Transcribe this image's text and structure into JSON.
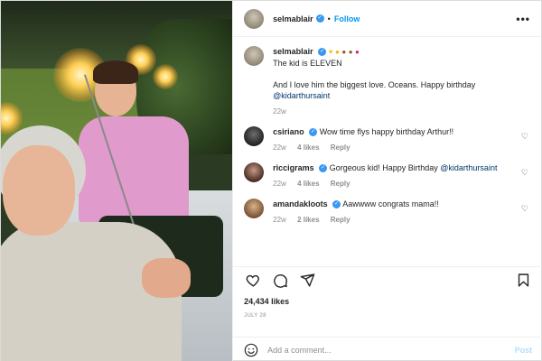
{
  "post": {
    "author": "selmablair",
    "follow_label": "Follow",
    "more_label": "•••",
    "caption_line1": "The kid is ELEVEN",
    "caption_line2_prefix": "And I love him the biggest love. Oceans. Happy birthday",
    "caption_mention": "@kidarthursaint",
    "caption_time": "22w"
  },
  "comments": [
    {
      "user": "csiriano",
      "text": "Wow time flys happy birthday Arthur!!",
      "time": "22w",
      "likes": "4 likes",
      "reply": "Reply"
    },
    {
      "user": "riccigrams",
      "text_prefix": "Gorgeous kid! Happy Birthday ",
      "mention": "@kidarthursaint",
      "time": "22w",
      "likes": "4 likes",
      "reply": "Reply"
    },
    {
      "user": "amandakloots",
      "text": "Aawwww congrats mama!!",
      "time": "22w",
      "likes": "2 likes",
      "reply": "Reply"
    }
  ],
  "stats": {
    "likes": "24,434 likes",
    "date": "JULY 28"
  },
  "add_comment": {
    "placeholder": "Add a comment...",
    "post_label": "Post"
  },
  "colors": {
    "accent": "#0095f6",
    "verified": "#3897f0",
    "muted": "#8e8e8e"
  },
  "icons": [
    "verified-badge-icon",
    "more-options-icon",
    "heart-icon",
    "comment-icon",
    "share-icon",
    "bookmark-icon",
    "emoji-icon"
  ]
}
